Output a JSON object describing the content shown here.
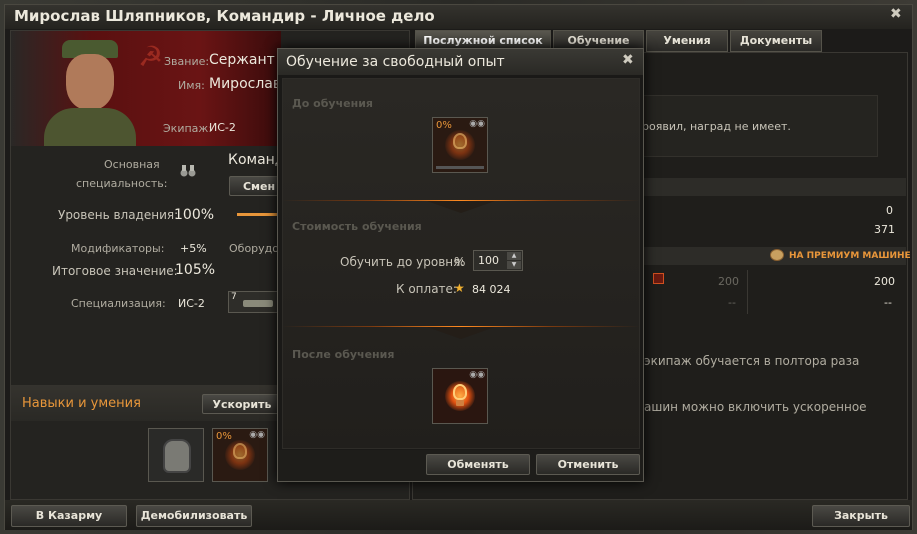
{
  "window": {
    "title": "Мирослав Шляпников, Командир - Личное дело",
    "close_glyph": "✖"
  },
  "crew": {
    "rank_label": "Звание:",
    "rank_value": "Сержант",
    "name_label": "Имя:",
    "name_value": "Мирослав",
    "crew_label": "Экипаж:",
    "crew_value": "ИС-2",
    "main_spec_label_1": "Основная",
    "main_spec_label_2": "специальность:",
    "role_value": "Командир",
    "change_button": "Смен",
    "mastery_label": "Уровень владения:",
    "mastery_value": "100%",
    "modifiers_label": "Модификаторы:",
    "modifiers_value": "+5%",
    "equipment_label": "Оборудов",
    "final_label": "Итоговое значение:",
    "final_value": "105%",
    "spec_label": "Специализация:",
    "spec_value": "ИС-2",
    "tank_tier": "7"
  },
  "skills": {
    "title": "Навыки и умения",
    "accelerate_button": "Ускорить",
    "new_skill_percent": "0%"
  },
  "tabs": [
    {
      "label": "Послужной список"
    },
    {
      "label": "Обучение"
    },
    {
      "label": "Умения"
    },
    {
      "label": "Документы"
    }
  ],
  "right_panel": {
    "awards_text": "роявил, наград не имеет.",
    "value_1": "0",
    "value_2": "371",
    "premium_label": "НА ПРЕМИУМ МАШИНЕ",
    "col_a_1": "200",
    "col_a_2": "--",
    "col_b_1": "200",
    "col_b_2": "--",
    "text_1": "экипаж обучается в полтора раза",
    "text_2": "ашин можно включить ускоренное"
  },
  "dialog": {
    "title": "Обучение за свободный опыт",
    "close_glyph": "✖",
    "before_title": "До обучения",
    "before_percent": "0%",
    "cost_title": "Стоимость обучения",
    "train_to_label": "Обучить до уровня:",
    "percent_sign": "%",
    "level_value": "100",
    "pay_label": "К оплате:",
    "pay_value": "84 024",
    "after_title": "После обучения",
    "apply_button": "Обменять",
    "cancel_button": "Отменить"
  },
  "bottom": {
    "barracks_button": "В Казарму",
    "demobilize_button": "Демобилизовать",
    "close_button": "Закрыть"
  },
  "colors": {
    "accent_orange": "#e8963a",
    "gold_star": "#f0b030",
    "title_text": "#ece8dc"
  }
}
